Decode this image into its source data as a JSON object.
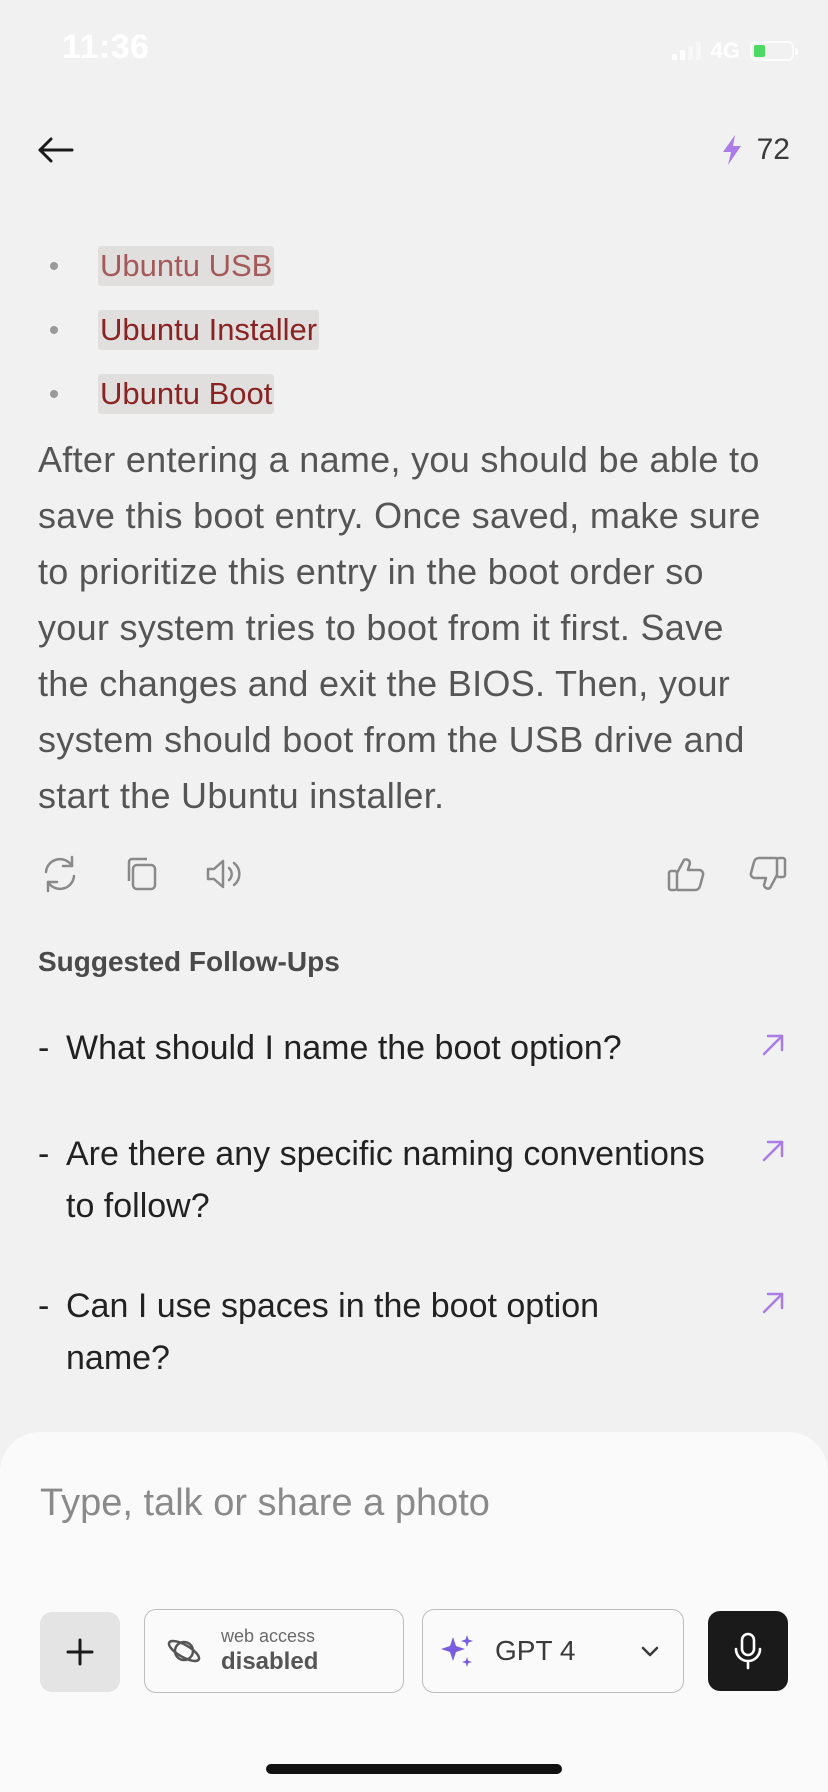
{
  "status_bar": {
    "time": "11:36",
    "network": "4G",
    "battery_level": 0.3,
    "battery_color": "#4cd964"
  },
  "header": {
    "back_icon": "arrow-left-icon",
    "credits_icon": "lightning-bolt-icon",
    "credits_value": "72",
    "accent_color": "#a97ce8"
  },
  "message": {
    "bullets": [
      {
        "label": "Ubuntu USB"
      },
      {
        "label": "Ubuntu Installer"
      },
      {
        "label": "Ubuntu Boot"
      }
    ],
    "paragraph": "After entering a name, you should be able to save this boot entry. Once saved, make sure to prioritize this entry in the boot order so your system tries to boot from it first. Save the changes and exit the BIOS. Then, your system should boot from the USB drive and start the Ubuntu installer.",
    "actions": [
      {
        "name": "regenerate-icon"
      },
      {
        "name": "copy-icon"
      },
      {
        "name": "speaker-icon"
      },
      {
        "name": "thumbs-up-icon"
      },
      {
        "name": "thumbs-down-icon"
      }
    ]
  },
  "suggested": {
    "heading": "Suggested Follow-Ups",
    "dash": "-",
    "items": [
      {
        "text": "What should I name the boot option?"
      },
      {
        "text": "Are there any specific naming conventions to follow?"
      },
      {
        "text": "Can I use spaces in the boot option name?"
      }
    ]
  },
  "composer": {
    "placeholder": "Type, talk or share a photo",
    "web_access_caption": "web access",
    "web_access_state": "disabled",
    "model_label": "GPT 4",
    "plus_icon": "plus-icon",
    "mic_icon": "microphone-icon"
  }
}
